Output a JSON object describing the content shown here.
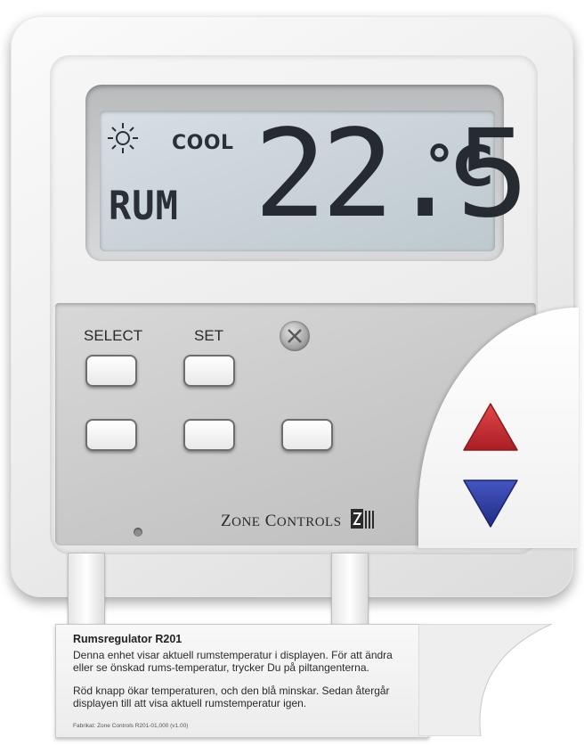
{
  "display": {
    "mode": "COOL",
    "label": "RUM",
    "temperature": "22.5",
    "unit": "°C",
    "icon": "sun-icon"
  },
  "buttons": {
    "select_label": "SELECT",
    "set_label": "SET"
  },
  "brand": {
    "name_first": "Z",
    "name_first_rest": "ONE",
    "name_second": "C",
    "name_second_rest": "ONTROLS"
  },
  "card": {
    "title": "Rumsregulator R201",
    "paragraph1": "Denna enhet visar aktuell rumstemperatur i displayen. För att ändra eller se önskad rums-temperatur, trycker Du på piltangenterna.",
    "paragraph2": "Röd knapp ökar temperaturen, och den blå minskar. Sedan återgår displayen till att visa aktuell rumstemperatur igen.",
    "footer": "Fabrikat: Zone Controls R201-01,000 (v1.00)"
  },
  "colors": {
    "arrow_up": "#c8282e",
    "arrow_down": "#2d3aa0",
    "lcd_background": "#cdd6db",
    "lcd_segments": "#2a3036"
  }
}
